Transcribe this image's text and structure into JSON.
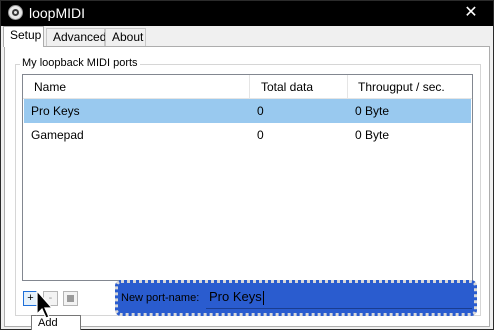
{
  "window": {
    "title": "loopMIDI",
    "close_glyph": "✕"
  },
  "tabs": [
    {
      "label": "Setup",
      "active": true
    },
    {
      "label": "Advanced",
      "active": false
    },
    {
      "label": "About",
      "active": false
    }
  ],
  "ports_group": {
    "label": "My loopback MIDI ports",
    "columns": [
      "Name",
      "Total data",
      "Througput / sec."
    ],
    "rows": [
      {
        "name": "Pro Keys",
        "total": "0",
        "throughput": "0 Byte",
        "selected": true
      },
      {
        "name": "Gamepad",
        "total": "0",
        "throughput": "0 Byte",
        "selected": false
      }
    ]
  },
  "controls": {
    "add_label": "+",
    "remove_label": "-",
    "tooltip": "Add Port",
    "new_port_label": "New port-name:",
    "new_port_value": "Pro Keys"
  },
  "colors": {
    "selection": "#99c9ef",
    "highlight_box": "#2a5ccf",
    "titlebar": "#000000"
  }
}
